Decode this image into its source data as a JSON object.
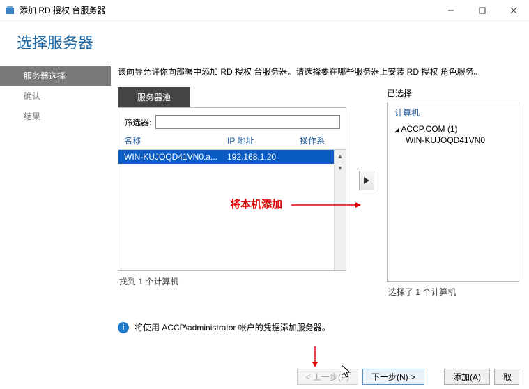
{
  "window": {
    "title": "添加 RD 授权 台服务器",
    "minimize": "—",
    "maximize": "☐",
    "close": "✕"
  },
  "heading": "选择服务器",
  "sidebar": {
    "items": [
      {
        "label": "服务器选择",
        "active": true
      },
      {
        "label": "确认",
        "active": false
      },
      {
        "label": "结果",
        "active": false
      }
    ]
  },
  "instruction": "该向导允许你向部署中添加 RD 授权 台服务器。请选择要在哪些服务器上安装 RD 授权 角色服务。",
  "pool": {
    "tab": "服务器池",
    "filter_label": "筛选器:",
    "columns": {
      "name": "名称",
      "ip": "IP 地址",
      "os": "操作系"
    },
    "row": {
      "name": "WIN-KUJOQD41VN0.a...",
      "ip": "192.168.1.20"
    },
    "found": "找到 1 个计算机"
  },
  "selected": {
    "title": "已选择",
    "header": "计算机",
    "domain": "ACCP.COM (1)",
    "host": "WIN-KUJOQD41VN0",
    "found": "选择了 1 个计算机"
  },
  "annotation": "将本机添加",
  "info": "将使用 ACCP\\administrator 帐户的凭据添加服务器。",
  "buttons": {
    "prev": "< 上一步(P)",
    "next": "下一步(N) >",
    "add": "添加(A)",
    "cancel": "取"
  }
}
